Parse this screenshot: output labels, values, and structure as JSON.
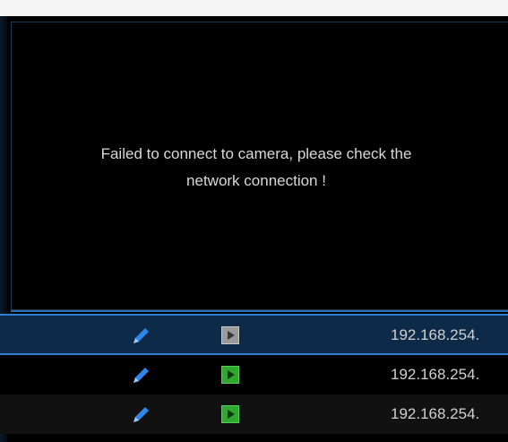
{
  "preview": {
    "message_line1": "Failed to connect to camera, please check the",
    "message_line2": "network connection !"
  },
  "camera_rows": [
    {
      "ip": "192.168.254.",
      "play_status": "inactive",
      "selected": true
    },
    {
      "ip": "192.168.254.",
      "play_status": "active",
      "selected": false
    },
    {
      "ip": "192.168.254.",
      "play_status": "active",
      "selected": false
    }
  ],
  "icons": {
    "edit": "pencil-icon",
    "play": "play-icon"
  },
  "colors": {
    "accent": "#2f7fd0",
    "selected_row": "#0d2a48",
    "play_active": "#2fa82f",
    "play_inactive": "#9a9a9a",
    "edit_icon": "#2f86e6"
  }
}
